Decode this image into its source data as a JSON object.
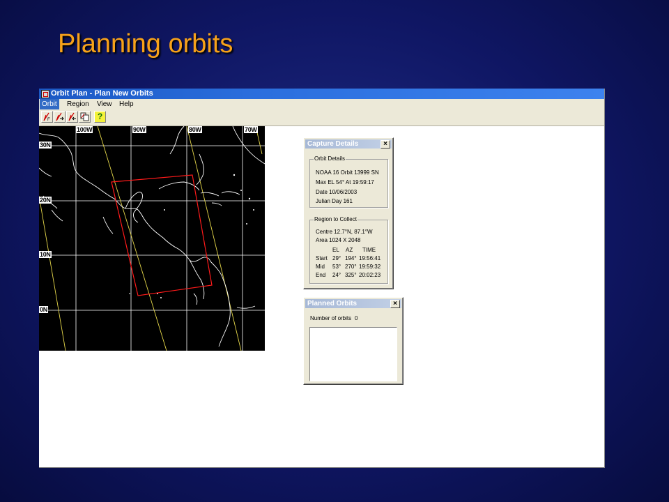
{
  "slide": {
    "title": "Planning orbits"
  },
  "window": {
    "title": "Orbit Plan - Plan New Orbits",
    "menu": [
      "Orbit",
      "Region",
      "View",
      "Help"
    ],
    "toolbar_icons": [
      "orbit-f-icon",
      "orbit-r-icon",
      "orbit-l-icon",
      "orbit-copy-icon",
      "help-icon"
    ],
    "help_glyph": "?"
  },
  "map": {
    "lon_labels": [
      "100W",
      "90W",
      "80W",
      "70W"
    ],
    "lat_labels": [
      "30N",
      "20N",
      "10N",
      "0N"
    ],
    "colors": {
      "background": "#000000",
      "coast": "#ffffff",
      "grid": "#ffffff",
      "track": "#e6d84a",
      "region": "#ff1a1a"
    }
  },
  "capture_details": {
    "title": "Capture Details",
    "close": "×",
    "orbit_group": "Orbit Details",
    "orbit_lines": [
      "NOAA 16   Orbit  13999 SN",
      "Max EL  54°   At  19:59:17",
      "Date  10/06/2003",
      "Julian Day  161"
    ],
    "region_group": "Region to Collect",
    "region_lines": [
      "Centre  12.7°N, 87.1°W",
      "Area  1024 X 2048"
    ],
    "table_header": [
      "EL",
      "AZ",
      "TIME"
    ],
    "table_rows": [
      [
        "Start",
        "29°",
        "194°",
        "19:56:41"
      ],
      [
        "Mid",
        "53°",
        "270°",
        "19:59:32"
      ],
      [
        "End",
        "24°",
        "325°",
        "20:02:23"
      ]
    ]
  },
  "planned_orbits": {
    "title": "Planned Orbits",
    "close": "×",
    "count_label": "Number of orbits",
    "count_value": "0"
  }
}
